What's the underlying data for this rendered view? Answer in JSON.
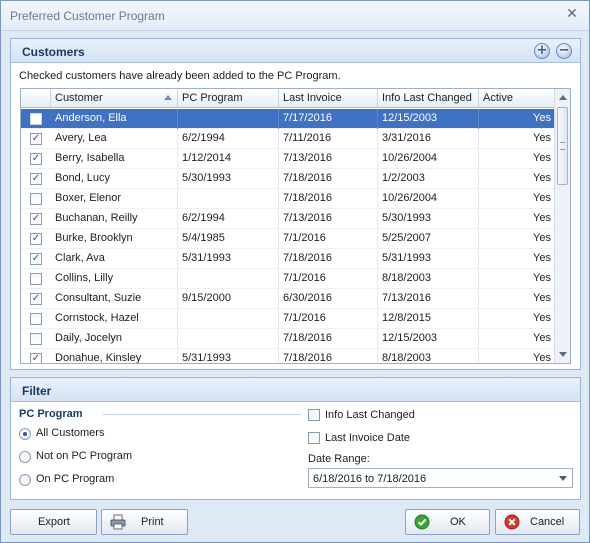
{
  "window": {
    "title": "Preferred Customer Program"
  },
  "customers": {
    "title": "Customers",
    "note": "Checked customers have already been added to the PC Program.",
    "columns": [
      "Customer",
      "PC Program",
      "Last Invoice",
      "Info Last Changed",
      "Active"
    ],
    "rows": [
      {
        "checked": false,
        "name": "Anderson, Ella",
        "pc": "",
        "invoice": "7/17/2016",
        "changed": "12/15/2003",
        "active": "Yes",
        "selected": true
      },
      {
        "checked": true,
        "name": "Avery, Lea",
        "pc": "6/2/1994",
        "invoice": "7/11/2016",
        "changed": "3/31/2016",
        "active": "Yes"
      },
      {
        "checked": true,
        "name": "Berry, Isabella",
        "pc": "1/12/2014",
        "invoice": "7/13/2016",
        "changed": "10/26/2004",
        "active": "Yes"
      },
      {
        "checked": true,
        "name": "Bond, Lucy",
        "pc": "5/30/1993",
        "invoice": "7/18/2016",
        "changed": "1/2/2003",
        "active": "Yes"
      },
      {
        "checked": false,
        "name": "Boxer, Elenor",
        "pc": "",
        "invoice": "7/18/2016",
        "changed": "10/26/2004",
        "active": "Yes"
      },
      {
        "checked": true,
        "name": "Buchanan, Reilly",
        "pc": "6/2/1994",
        "invoice": "7/13/2016",
        "changed": "5/30/1993",
        "active": "Yes"
      },
      {
        "checked": true,
        "name": "Burke, Brooklyn",
        "pc": "5/4/1985",
        "invoice": "7/1/2016",
        "changed": "5/25/2007",
        "active": "Yes"
      },
      {
        "checked": true,
        "name": "Clark, Ava",
        "pc": "5/31/1993",
        "invoice": "7/18/2016",
        "changed": "5/31/1993",
        "active": "Yes"
      },
      {
        "checked": false,
        "name": "Collins, Lilly",
        "pc": "",
        "invoice": "7/1/2016",
        "changed": "8/18/2003",
        "active": "Yes"
      },
      {
        "checked": true,
        "name": "Consultant, Suzie",
        "pc": "9/15/2000",
        "invoice": "6/30/2016",
        "changed": "7/13/2016",
        "active": "Yes"
      },
      {
        "checked": false,
        "name": "Cornstock, Hazel",
        "pc": "",
        "invoice": "7/1/2016",
        "changed": "12/8/2015",
        "active": "Yes"
      },
      {
        "checked": false,
        "name": "Daily, Jocelyn",
        "pc": "",
        "invoice": "7/18/2016",
        "changed": "12/15/2003",
        "active": "Yes"
      },
      {
        "checked": true,
        "name": "Donahue, Kinsley",
        "pc": "5/31/1993",
        "invoice": "7/18/2016",
        "changed": "8/18/2003",
        "active": "Yes"
      }
    ]
  },
  "filter": {
    "title": "Filter",
    "pc_program_label": "PC Program",
    "radios": [
      {
        "label": "All Customers",
        "checked": true
      },
      {
        "label": "Not on PC Program",
        "checked": false
      },
      {
        "label": "On PC Program",
        "checked": false
      }
    ],
    "checks": [
      {
        "label": "Info Last Changed",
        "checked": false
      },
      {
        "label": "Last Invoice Date",
        "checked": false
      }
    ],
    "date_range_label": "Date Range:",
    "date_range_value": "6/18/2016 to 7/18/2016"
  },
  "buttons": {
    "export": "Export",
    "print": "Print",
    "ok": "OK",
    "cancel": "Cancel"
  },
  "icons": {
    "close": "close-icon",
    "add": "plus-circle-icon",
    "remove": "minus-circle-icon",
    "print": "printer-icon",
    "ok": "check-circle-icon",
    "cancel": "cancel-circle-icon"
  },
  "colors": {
    "selection": "#3f72c2",
    "header_text": "#1b3a66",
    "ok_green": "#3aa335",
    "cancel_red": "#d23a2f"
  }
}
